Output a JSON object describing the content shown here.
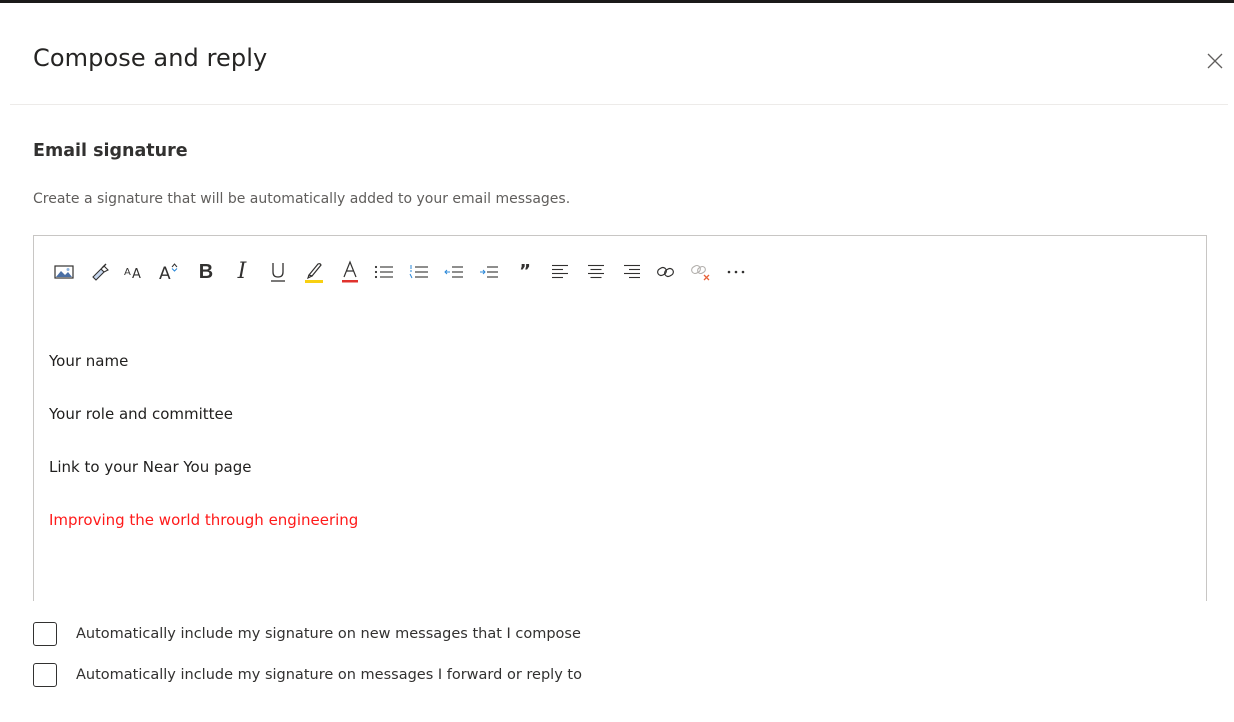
{
  "panel": {
    "title": "Compose and reply"
  },
  "email_signature": {
    "heading": "Email signature",
    "description": "Create a signature that will be automatically added to your email messages.",
    "toolbar_icons": [
      "insert-picture-icon",
      "format-painter-icon",
      "font-size-icon",
      "grow-font-icon",
      "bold-icon",
      "italic-icon",
      "underline-icon",
      "highlight-icon",
      "font-color-icon",
      "bullets-icon",
      "numbering-icon",
      "decrease-indent-icon",
      "increase-indent-icon",
      "quote-icon",
      "align-left-icon",
      "align-center-icon",
      "align-right-icon",
      "insert-link-icon",
      "remove-link-icon",
      "more-options-icon"
    ],
    "lines": [
      "Your name",
      "Your role and committee",
      "Link to your Near You page",
      "Improving the world through engineering"
    ],
    "tagline_color": "#ff1a1a"
  },
  "options": {
    "include_new": {
      "label": "Automatically include my signature on new messages that I compose",
      "checked": false
    },
    "include_reply": {
      "label": "Automatically include my signature on messages I forward or reply to",
      "checked": false
    }
  },
  "colors": {
    "highlight_swatch": "#f8d012",
    "font_color_swatch": "#e0332e",
    "remove_link_x": "#e8623a"
  }
}
